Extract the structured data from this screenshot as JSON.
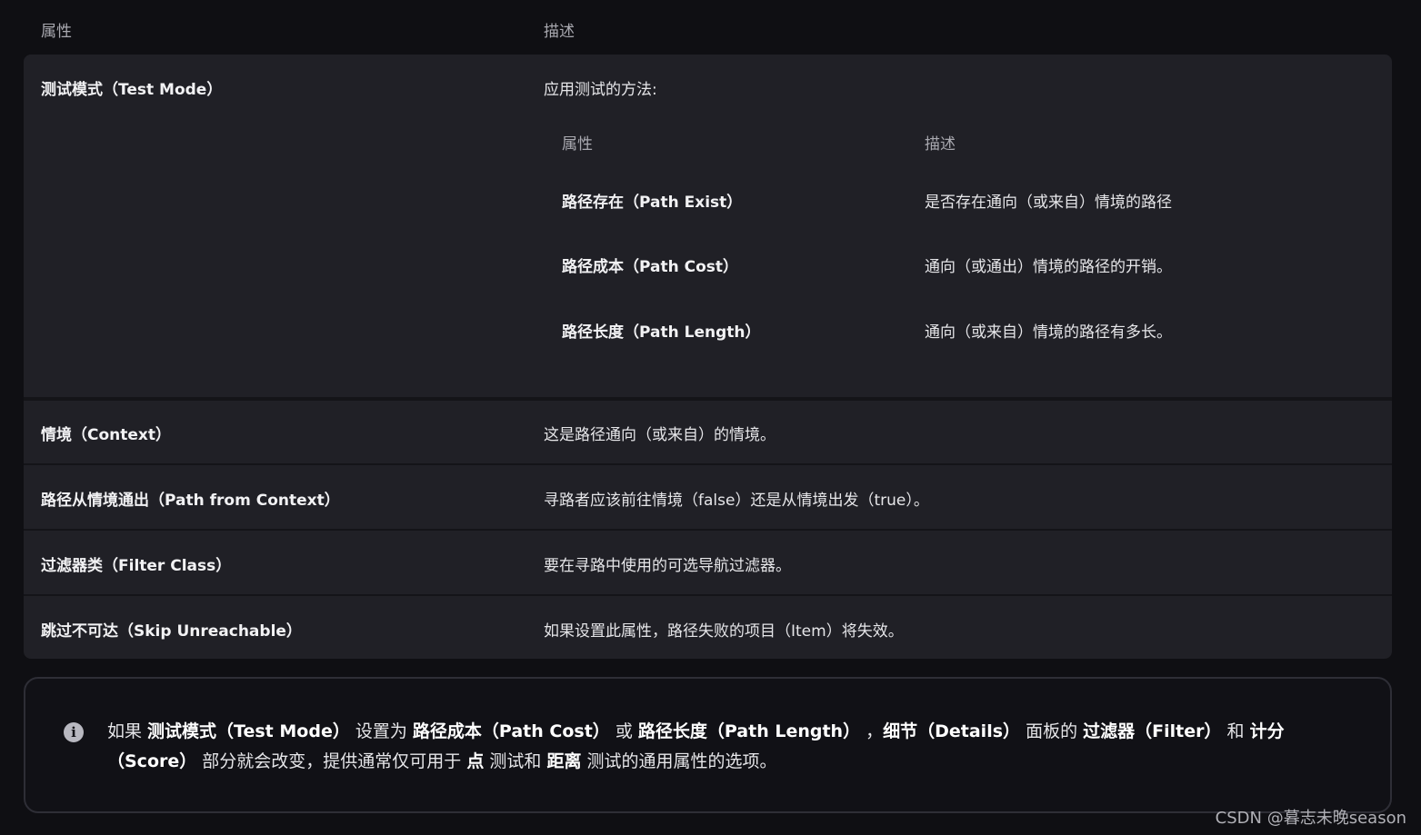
{
  "header": {
    "col1": "属性",
    "col2": "描述"
  },
  "rows": [
    {
      "key": "测试模式（Test Mode）",
      "value": "应用测试的方法:",
      "nested": {
        "col1": "属性",
        "col2": "描述",
        "rows": [
          {
            "key": "路径存在（Path Exist）",
            "value": "是否存在通向（或来自）情境的路径"
          },
          {
            "key": "路径成本（Path Cost）",
            "value": "通向（或通出）情境的路径的开销。"
          },
          {
            "key": "路径长度（Path Length）",
            "value": "通向（或来自）情境的路径有多长。"
          }
        ]
      }
    },
    {
      "key": "情境（Context）",
      "value": "这是路径通向（或来自）的情境。"
    },
    {
      "key": "路径从情境通出（Path from Context）",
      "value": "寻路者应该前往情境（false）还是从情境出发（true）。"
    },
    {
      "key": "过滤器类（Filter Class）",
      "value": "要在寻路中使用的可选导航过滤器。"
    },
    {
      "key": "跳过不可达（Skip Unreachable）",
      "value": "如果设置此属性，路径失败的项目（Item）将失效。"
    }
  ],
  "note": {
    "icon": "info-icon",
    "t1": "如果 ",
    "b1": "测试模式（Test Mode）",
    "t2": " 设置为 ",
    "b2": "路径成本（Path Cost）",
    "t3": " 或 ",
    "b3": "路径长度（Path Length）",
    "t4": " ，",
    "b4": "细节（Details）",
    "t5": " 面板的 ",
    "b5": "过滤器（Filter）",
    "t6": " 和 ",
    "b6": "计分（Score）",
    "t7": " 部分就会改变，提供通常仅可用于 ",
    "b7": "点",
    "t8": " 测试和 ",
    "b8": "距离",
    "t9": " 测试的通用属性的选项。"
  },
  "watermark": "CSDN @暮志未晚season",
  "colors": {
    "background": "#0f0f13",
    "table_body": "#202026",
    "separator": "#141418"
  }
}
